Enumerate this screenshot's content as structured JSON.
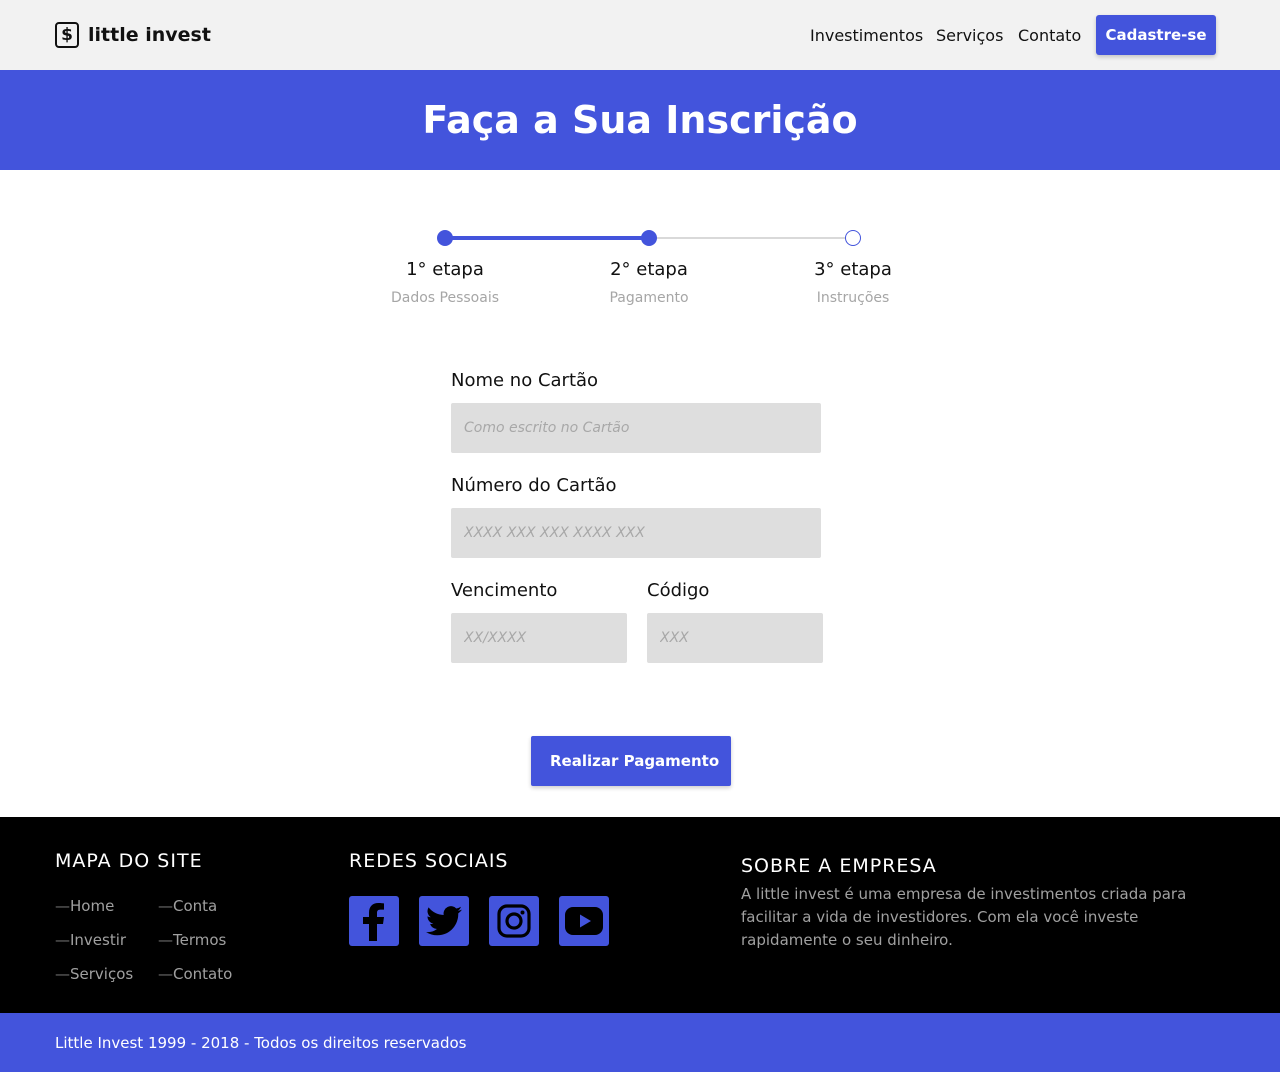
{
  "header": {
    "logo_symbol": "$",
    "logo_text": "little invest",
    "nav": [
      "Investimentos",
      "Serviços",
      "Contato"
    ],
    "signup_label": "Cadastre-se"
  },
  "banner": {
    "title": "Faça a Sua Inscrição"
  },
  "stepper": {
    "current_step": 2,
    "steps": [
      {
        "title": "1° etapa",
        "subtitle": "Dados Pessoais",
        "status": "done"
      },
      {
        "title": "2° etapa",
        "subtitle": "Pagamento",
        "status": "done"
      },
      {
        "title": "3° etapa",
        "subtitle": "Instruções",
        "status": "pending"
      }
    ]
  },
  "form": {
    "card_name": {
      "label": "Nome no Cartão",
      "placeholder": "Como escrito no Cartão",
      "value": ""
    },
    "card_number": {
      "label": "Número do Cartão",
      "placeholder": "XXXX XXX XXX XXXX XXX",
      "value": ""
    },
    "expiry": {
      "label": "Vencimento",
      "placeholder": "XX/XXXX",
      "value": ""
    },
    "cvv": {
      "label": "Código",
      "placeholder": "XXX",
      "value": ""
    },
    "submit_label": "Realizar Pagamento"
  },
  "footer": {
    "sitemap": {
      "heading": "MAPA DO SITE",
      "dash": "—",
      "links": [
        "Home",
        "Conta",
        "Investir",
        "Termos",
        "Serviços",
        "Contato"
      ]
    },
    "social": {
      "heading": "REDES SOCIAIS",
      "icons": [
        "facebook-icon",
        "twitter-icon",
        "instagram-icon",
        "youtube-icon"
      ]
    },
    "about": {
      "heading": "SOBRE A EMPRESA",
      "text": "A little invest é uma empresa de investimentos criada para facilitar a vida de investidores. Com ela você investe rapidamente o seu dinheiro."
    },
    "copyright": "Little Invest 1999 - 2018 - Todos os direitos reservados"
  },
  "colors": {
    "accent": "#4354dc",
    "header_bg": "#f2f2f2",
    "footer_bg": "#000000",
    "field_bg": "#dedede"
  }
}
